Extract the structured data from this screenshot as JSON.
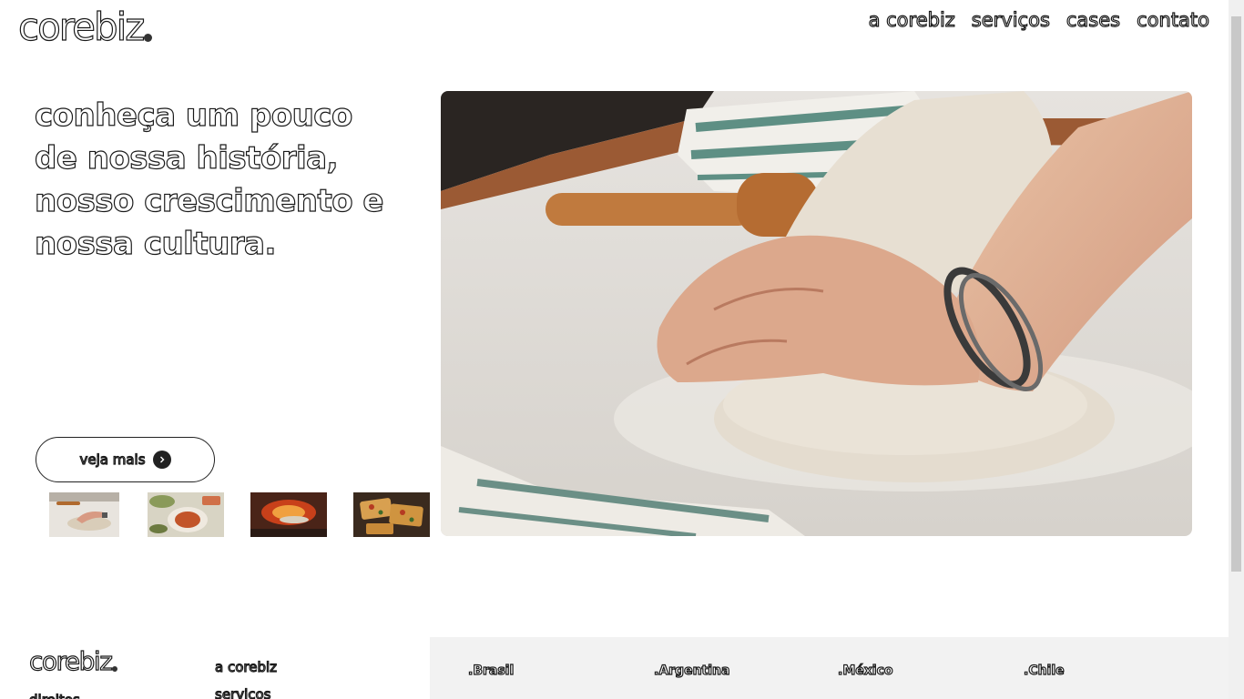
{
  "header": {
    "logo": "corebiz",
    "nav": [
      "a corebiz",
      "serviços",
      "cases",
      "contato"
    ]
  },
  "hero": {
    "title_lines": [
      "conheça um pouco",
      "de nossa história,",
      "nosso crescimento e",
      "nossa cultura."
    ],
    "button_label": "veja mais"
  },
  "footer": {
    "logo": "corebiz",
    "left_links": [
      "direitos",
      "a corebiz",
      "serviços"
    ],
    "countries": [
      ".Brasil",
      ".Argentina",
      ".México",
      ".Chile"
    ]
  },
  "colors": {
    "accent": "#222222",
    "footer_panel": "#f2f2f2"
  }
}
